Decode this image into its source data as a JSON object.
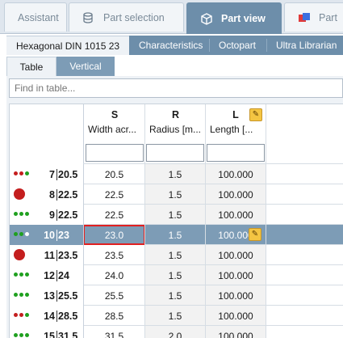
{
  "top_tabs": {
    "assistant": "Assistant",
    "part_selection": "Part selection",
    "part_view": "Part view",
    "part_overflow": "Part"
  },
  "sub_tabs": {
    "part_name": "Hexagonal DIN 1015 23",
    "characteristics": "Characteristics",
    "octopart": "Octopart",
    "ultra_librarian": "Ultra Librarian"
  },
  "view_tabs": {
    "table": "Table",
    "vertical": "Vertical"
  },
  "search": {
    "placeholder": "Find in table..."
  },
  "columns": [
    {
      "letter": "S",
      "name": "Width acr..."
    },
    {
      "letter": "R",
      "name": "Radius [m..."
    },
    {
      "letter": "L",
      "name": "Length [..."
    }
  ],
  "rows": [
    {
      "status": "red-dots",
      "index": "7",
      "alt": "20.5",
      "s": "20.5",
      "r": "1.5",
      "l": "100.000"
    },
    {
      "status": "red-circle",
      "index": "8",
      "alt": "22.5",
      "s": "22.5",
      "r": "1.5",
      "l": "100.000"
    },
    {
      "status": "green-dots",
      "index": "9",
      "alt": "22.5",
      "s": "22.5",
      "r": "1.5",
      "l": "100.000"
    },
    {
      "status": "green-dots",
      "index": "10",
      "alt": "23",
      "s": "23.0",
      "r": "1.5",
      "l": "100.000"
    },
    {
      "status": "red-circle",
      "index": "11",
      "alt": "23.5",
      "s": "23.5",
      "r": "1.5",
      "l": "100.000"
    },
    {
      "status": "green-dots",
      "index": "12",
      "alt": "24",
      "s": "24.0",
      "r": "1.5",
      "l": "100.000"
    },
    {
      "status": "green-dots",
      "index": "13",
      "alt": "25.5",
      "s": "25.5",
      "r": "1.5",
      "l": "100.000"
    },
    {
      "status": "red-dots",
      "index": "14",
      "alt": "28.5",
      "s": "28.5",
      "r": "1.5",
      "l": "100.000"
    },
    {
      "status": "green-dots",
      "index": "15",
      "alt": "31.5",
      "s": "31.5",
      "r": "2.0",
      "l": "100.000"
    }
  ],
  "selected_row": "10",
  "colors": {
    "accent": "#6d8eaa",
    "selected": "#7d9cb6",
    "status_red": "#c41e1e",
    "status_green": "#1fa01f",
    "highlight": "#e02020"
  }
}
